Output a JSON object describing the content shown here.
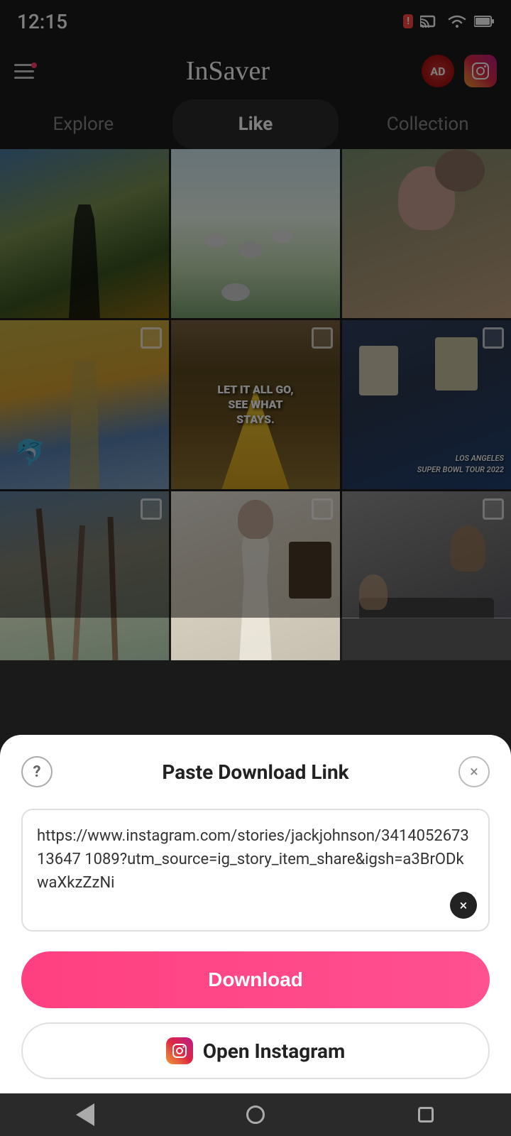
{
  "statusBar": {
    "time": "12:15",
    "alert": "!",
    "icons": [
      "cast",
      "wifi",
      "battery"
    ]
  },
  "appBar": {
    "title": "InSaver",
    "adLabel": "AD",
    "instagramIcon": "📷"
  },
  "tabs": [
    {
      "id": "explore",
      "label": "Explore",
      "active": false
    },
    {
      "id": "like",
      "label": "Like",
      "active": true
    },
    {
      "id": "collection",
      "label": "Collection",
      "active": false
    }
  ],
  "modal": {
    "helpIcon": "?",
    "closeIcon": "×",
    "title": "Paste Download Link",
    "urlValue": "https://www.instagram.com/stories/jackjohnson/341405267313647 1089?utm_source=ig_story_item_share&igsh=a3BrODkwaXkzZzNi",
    "clearBtn": "×",
    "downloadBtn": "Download",
    "openInstagramBtn": "Open Instagram"
  },
  "photoGrid": [
    {
      "id": 1,
      "class": "photo-1",
      "hasCheckbox": false,
      "text": ""
    },
    {
      "id": 2,
      "class": "photo-2",
      "hasCheckbox": false,
      "text": ""
    },
    {
      "id": 3,
      "class": "photo-3",
      "hasCheckbox": false,
      "text": ""
    },
    {
      "id": 4,
      "class": "photo-4",
      "hasCheckbox": true,
      "text": ""
    },
    {
      "id": 5,
      "class": "photo-5",
      "hasCheckbox": true,
      "centerText": "LET IT ALL GO,\nSEE WHAT\nSTAYS."
    },
    {
      "id": 6,
      "class": "photo-6",
      "hasCheckbox": true,
      "overlayText": "LOS ANGELES\nSUPER BOWL TOUR 2022"
    },
    {
      "id": 7,
      "class": "photo-7",
      "hasCheckbox": true,
      "text": ""
    },
    {
      "id": 8,
      "class": "photo-8",
      "hasCheckbox": true,
      "text": ""
    },
    {
      "id": 9,
      "class": "photo-9",
      "hasCheckbox": true,
      "text": ""
    }
  ],
  "navBar": {
    "backBtn": "◀",
    "homeBtn": "●",
    "squareBtn": "■"
  }
}
